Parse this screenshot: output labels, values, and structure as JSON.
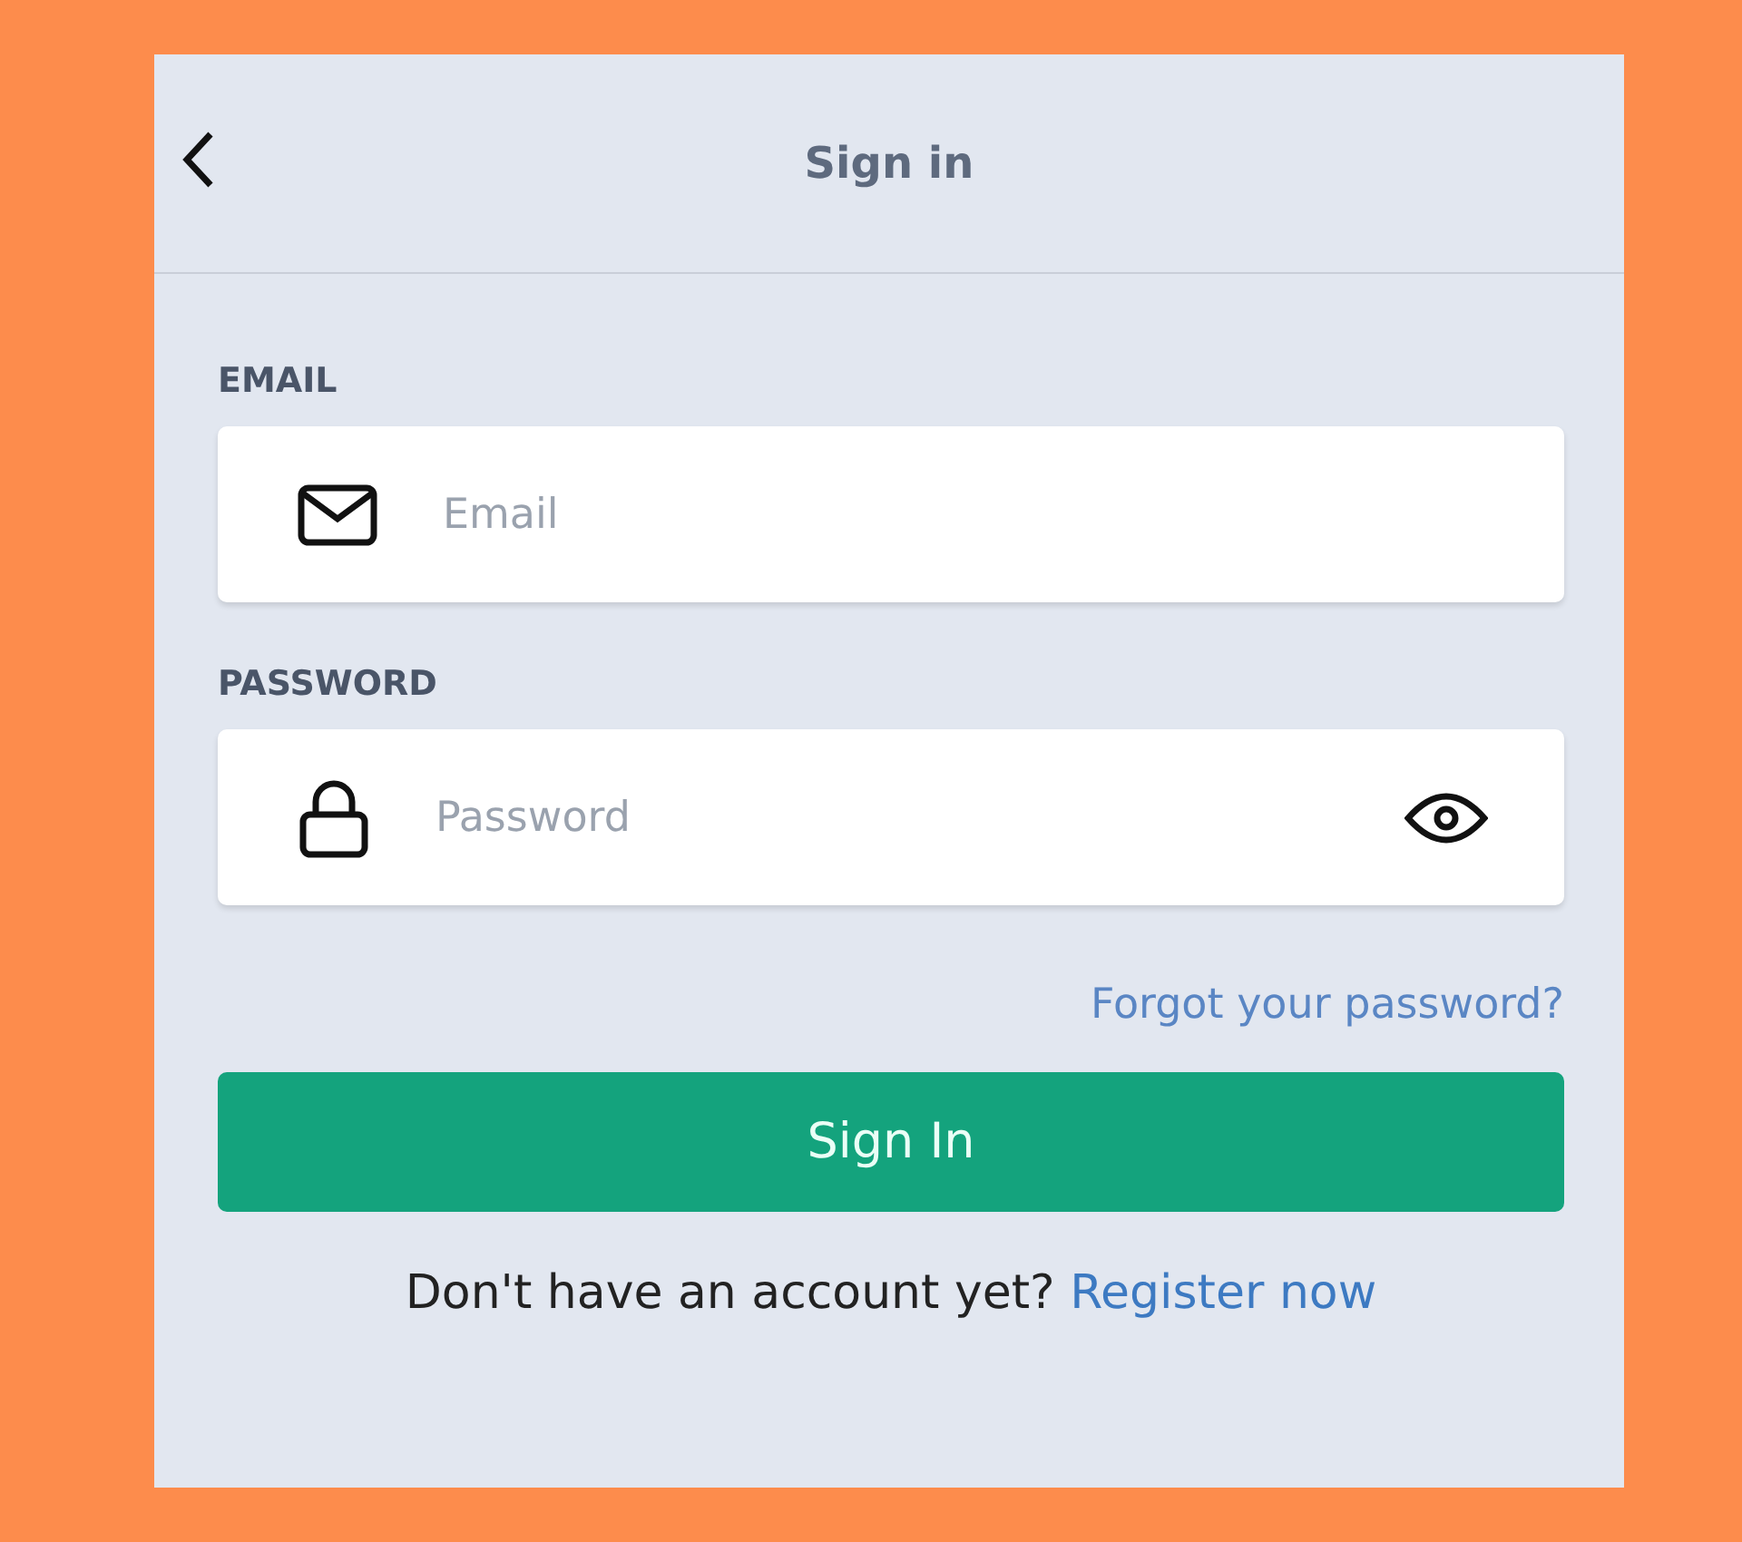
{
  "header": {
    "title": "Sign in"
  },
  "fields": [
    {
      "kind": "email",
      "label": "EMAIL",
      "placeholder": "Email"
    },
    {
      "kind": "password",
      "label": "PASSWORD",
      "placeholder": "Password"
    }
  ],
  "forgot_link": "Forgot your password?",
  "submit_button": "Sign In",
  "register": {
    "prompt": "Don't have an account yet?",
    "link": "Register now"
  }
}
